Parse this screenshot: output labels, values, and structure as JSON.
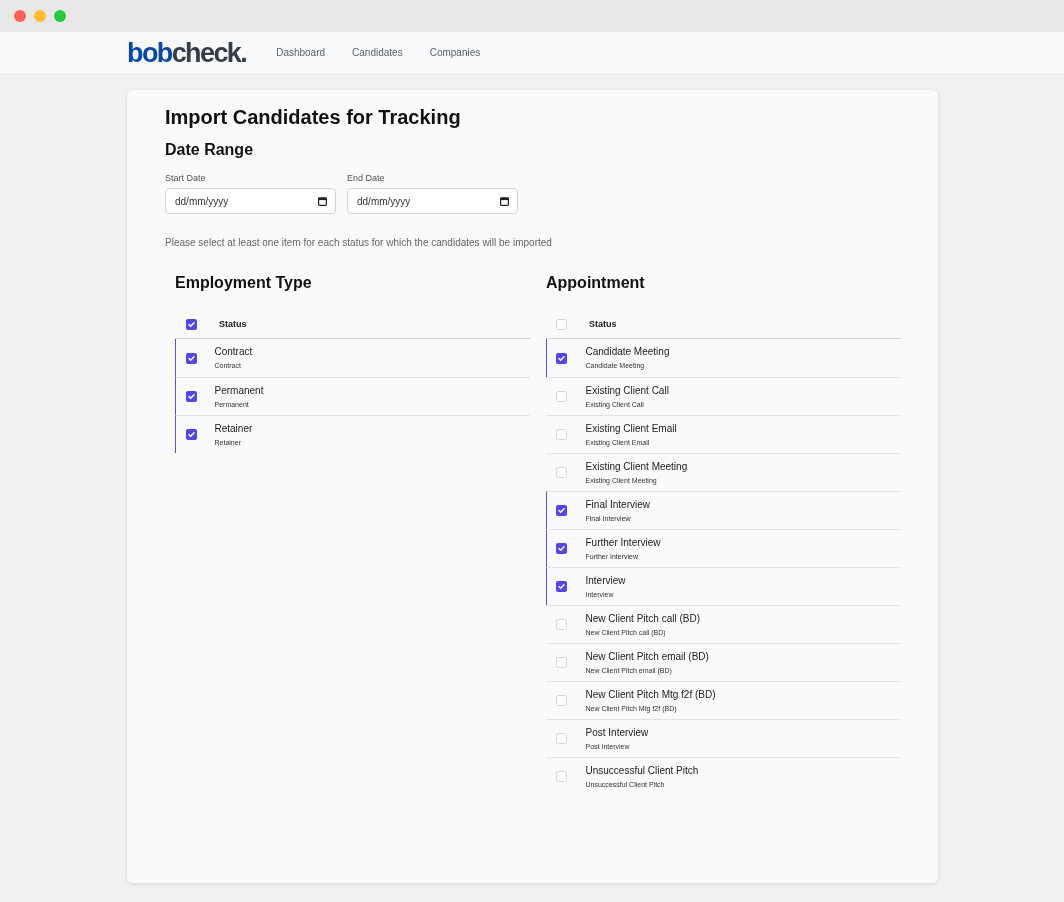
{
  "nav": {
    "logo": [
      "bob",
      "check."
    ],
    "links": [
      "Dashboard",
      "Candidates",
      "Companies"
    ]
  },
  "page": {
    "title": "Import Candidates for Tracking",
    "date_range": {
      "heading": "Date Range",
      "fields": [
        {
          "label": "Start Date",
          "placeholder": "dd/mm/yyyy"
        },
        {
          "label": "End Date",
          "placeholder": "dd/mm/yyyy"
        }
      ]
    },
    "note": "Please select at least one item for each status for which the candidates will be imported"
  },
  "sections": [
    {
      "heading": "Employment Type",
      "header": {
        "label": "Status",
        "checked": true
      },
      "rows": [
        {
          "label": "Contract",
          "sublabel": "Contract",
          "checked": true
        },
        {
          "label": "Permanent",
          "sublabel": "Permanent",
          "checked": true
        },
        {
          "label": "Retainer",
          "sublabel": "Retainer",
          "checked": true
        }
      ]
    },
    {
      "heading": "Appointment",
      "header": {
        "label": "Status",
        "checked": false
      },
      "rows": [
        {
          "label": "Candidate Meeting",
          "sublabel": "Candidate Meeting",
          "checked": true
        },
        {
          "label": "Existing Client Call",
          "sublabel": "Existing Client Call",
          "checked": false
        },
        {
          "label": "Existing Client Email",
          "sublabel": "Existing Client Email",
          "checked": false
        },
        {
          "label": "Existing Client Meeting",
          "sublabel": "Existing Client Meeting",
          "checked": false
        },
        {
          "label": "Final Interview",
          "sublabel": "Final Interview",
          "checked": true
        },
        {
          "label": "Further Interview",
          "sublabel": "Further Interview",
          "checked": true
        },
        {
          "label": "Interview",
          "sublabel": "Interview",
          "checked": true
        },
        {
          "label": "New Client Pitch call (BD)",
          "sublabel": "New Client Pitch call (BD)",
          "checked": false
        },
        {
          "label": "New Client Pitch email (BD)",
          "sublabel": "New Client Pitch email (BD)",
          "checked": false
        },
        {
          "label": "New Client Pitch Mtg f2f (BD)",
          "sublabel": "New Client Pitch Mtg f2f (BD)",
          "checked": false
        },
        {
          "label": "Post Interview",
          "sublabel": "Post Interview",
          "checked": false
        },
        {
          "label": "Unsuccessful Client Pitch",
          "sublabel": "Unsuccessful Client Pitch",
          "checked": false
        }
      ]
    }
  ]
}
